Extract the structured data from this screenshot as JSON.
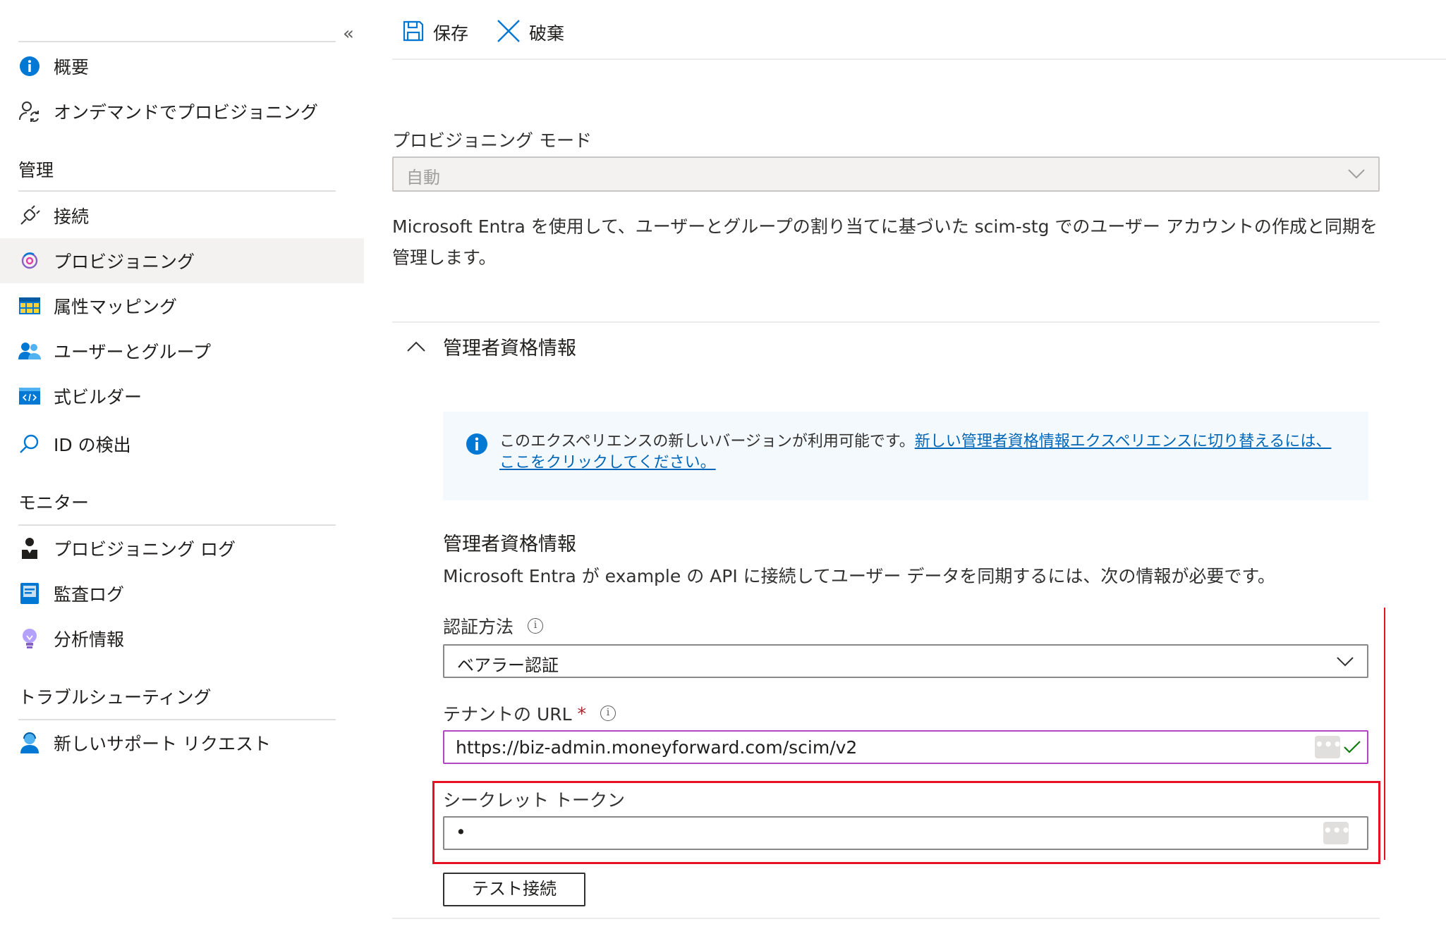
{
  "sidebar": {
    "collapse_glyph": "«",
    "items_top": [
      {
        "label": "概要",
        "icon": "info-circle-icon"
      },
      {
        "label": "オンデマンドでプロビジョニング",
        "icon": "user-sync-icon"
      }
    ],
    "section_manage": {
      "title": "管理",
      "items": [
        {
          "label": "接続",
          "icon": "plug-icon"
        },
        {
          "label": "プロビジョニング",
          "icon": "provisioning-icon",
          "active": true
        },
        {
          "label": "属性マッピング",
          "icon": "table-icon"
        },
        {
          "label": "ユーザーとグループ",
          "icon": "users-icon"
        },
        {
          "label": "式ビルダー",
          "icon": "code-icon"
        },
        {
          "label": "ID の検出",
          "icon": "search-icon"
        }
      ]
    },
    "section_monitor": {
      "title": "モニター",
      "items": [
        {
          "label": "プロビジョニング ログ",
          "icon": "person-log-icon"
        },
        {
          "label": "監査ログ",
          "icon": "book-icon"
        },
        {
          "label": "分析情報",
          "icon": "lightbulb-icon"
        }
      ]
    },
    "section_troubleshoot": {
      "title": "トラブルシューティング",
      "items": [
        {
          "label": "新しいサポート リクエスト",
          "icon": "support-person-icon"
        }
      ]
    }
  },
  "toolbar": {
    "save_label": "保存",
    "discard_label": "破棄"
  },
  "provisioning_mode": {
    "label": "プロビジョニング モード",
    "value": "自動",
    "description": "Microsoft Entra を使用して、ユーザーとグループの割り当てに基づいた scim-stg でのユーザー アカウントの作成と同期を管理します。"
  },
  "admin_credentials": {
    "section_title": "管理者資格情報",
    "info_text": "このエクスペリエンスの新しいバージョンが利用可能です。",
    "info_link": "新しい管理者資格情報エクスペリエンスに切り替えるには、ここをクリックしてください。",
    "heading": "管理者資格情報",
    "description": "Microsoft Entra が example の API に接続してユーザー データを同期するには、次の情報が必要です。",
    "auth_method": {
      "label": "認証方法",
      "value": "ベアラー認証"
    },
    "tenant_url": {
      "label": "テナントの URL",
      "required_mark": "*",
      "value": "https://biz-admin.moneyforward.com/scim/v2"
    },
    "secret_token": {
      "label": "シークレット トークン",
      "value": "•"
    },
    "test_button": "テスト接続"
  },
  "colors": {
    "accent_blue": "#0078d4",
    "highlight_red": "#e81123",
    "focus_purple": "#b146c2",
    "success_green": "#107c10"
  }
}
